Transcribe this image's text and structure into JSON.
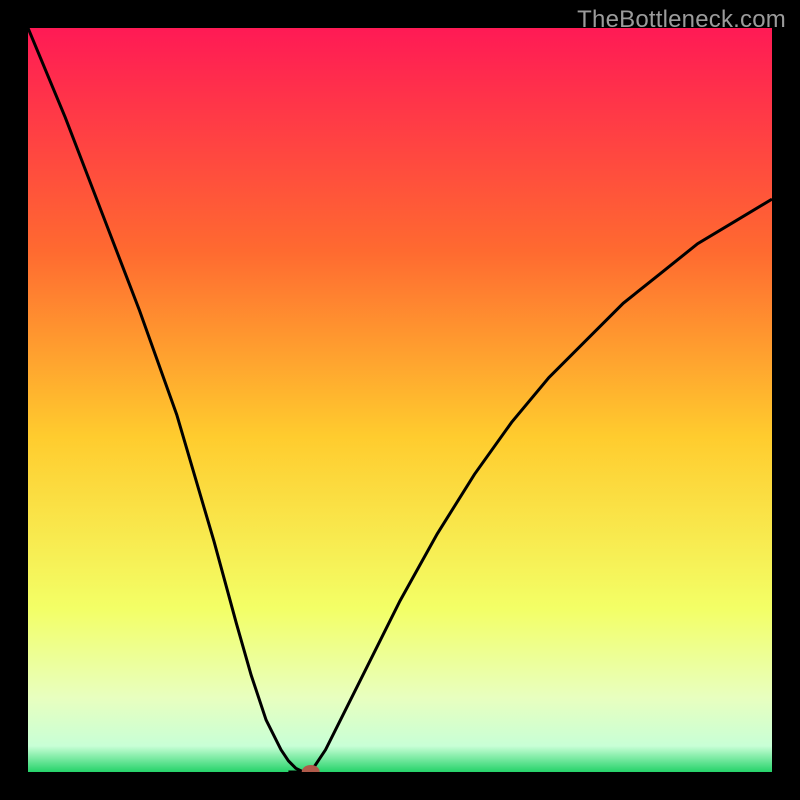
{
  "watermark": "TheBottleneck.com",
  "colors": {
    "background": "#000000",
    "watermark": "#9b9b9b",
    "curve": "#000000",
    "marker": "#b05a4a",
    "gradient_top": "#ff1a55",
    "gradient_mid1": "#ff8a2a",
    "gradient_mid2": "#ffe836",
    "gradient_low": "#f6ff9e",
    "gradient_bottom": "#2dd36f"
  },
  "chart_data": {
    "type": "line",
    "title": "",
    "xlabel": "",
    "ylabel": "",
    "xlim": [
      0,
      100
    ],
    "ylim": [
      0,
      100
    ],
    "series": [
      {
        "name": "bottleneck-curve-left",
        "x": [
          0,
          5,
          10,
          15,
          20,
          25,
          28,
          30,
          32,
          34,
          35,
          36,
          37
        ],
        "values": [
          100,
          88,
          75,
          62,
          48,
          31,
          20,
          13,
          7,
          3,
          1.5,
          0.5,
          0
        ]
      },
      {
        "name": "bottleneck-plateau",
        "x": [
          35,
          36,
          37,
          38
        ],
        "values": [
          0,
          0,
          0,
          0
        ]
      },
      {
        "name": "bottleneck-curve-right",
        "x": [
          38,
          40,
          42,
          45,
          50,
          55,
          60,
          65,
          70,
          75,
          80,
          85,
          90,
          95,
          100
        ],
        "values": [
          0,
          3,
          7,
          13,
          23,
          32,
          40,
          47,
          53,
          58,
          63,
          67,
          71,
          74,
          77
        ]
      }
    ],
    "marker": {
      "x": 38,
      "y": 0,
      "name": "optimum-point"
    },
    "gradient_stops": [
      {
        "offset": 0.0,
        "color": "#ff1a55"
      },
      {
        "offset": 0.3,
        "color": "#ff6a30"
      },
      {
        "offset": 0.55,
        "color": "#ffcc2e"
      },
      {
        "offset": 0.78,
        "color": "#f3ff66"
      },
      {
        "offset": 0.9,
        "color": "#e8ffbf"
      },
      {
        "offset": 0.965,
        "color": "#c8ffd6"
      },
      {
        "offset": 1.0,
        "color": "#25d36a"
      }
    ]
  }
}
